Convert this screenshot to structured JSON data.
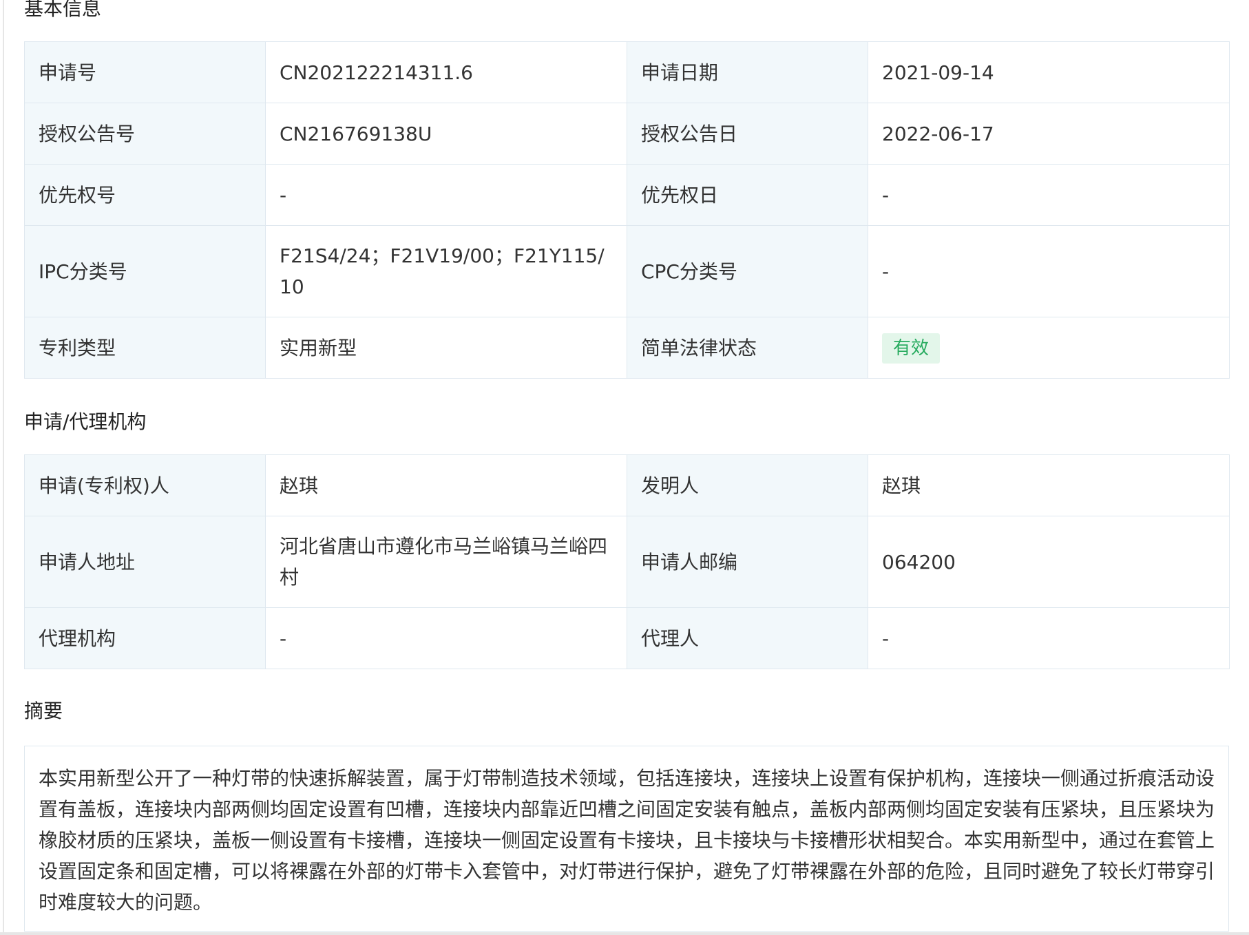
{
  "basic_info": {
    "title": "基本信息",
    "rows": [
      {
        "label1": "申请号",
        "value1": "CN202122214311.6",
        "label2": "申请日期",
        "value2": "2021-09-14"
      },
      {
        "label1": "授权公告号",
        "value1": "CN216769138U",
        "label2": "授权公告日",
        "value2": "2022-06-17"
      },
      {
        "label1": "优先权号",
        "value1": "-",
        "label2": "优先权日",
        "value2": "-"
      },
      {
        "label1": "IPC分类号",
        "value1": "F21S4/24；F21V19/00；F21Y115/10",
        "label2": "CPC分类号",
        "value2": "-"
      },
      {
        "label1": "专利类型",
        "value1": "实用新型",
        "label2": "简单法律状态",
        "value2": "有效"
      }
    ],
    "status_color": "#27ab5f"
  },
  "agency": {
    "title": "申请/代理机构",
    "rows": [
      {
        "label1": "申请(专利权)人",
        "value1": "赵琪",
        "label2": "发明人",
        "value2": "赵琪"
      },
      {
        "label1": "申请人地址",
        "value1": "河北省唐山市遵化市马兰峪镇马兰峪四村",
        "label2": "申请人邮编",
        "value2": "064200"
      },
      {
        "label1": "代理机构",
        "value1": "-",
        "label2": "代理人",
        "value2": "-"
      }
    ]
  },
  "abstract": {
    "title": "摘要",
    "text": "本实用新型公开了一种灯带的快速拆解装置，属于灯带制造技术领域，包括连接块，连接块上设置有保护机构，连接块一侧通过折痕活动设置有盖板，连接块内部两侧均固定设置有凹槽，连接块内部靠近凹槽之间固定安装有触点，盖板内部两侧均固定安装有压紧块，且压紧块为橡胶材质的压紧块，盖板一侧设置有卡接槽，连接块一侧固定设置有卡接块，且卡接块与卡接槽形状相契合。本实用新型中，通过在套管上设置固定条和固定槽，可以将裸露在外部的灯带卡入套管中，对灯带进行保护，避免了灯带裸露在外部的危险，且同时避免了较长灯带穿引时难度较大的问题。"
  }
}
